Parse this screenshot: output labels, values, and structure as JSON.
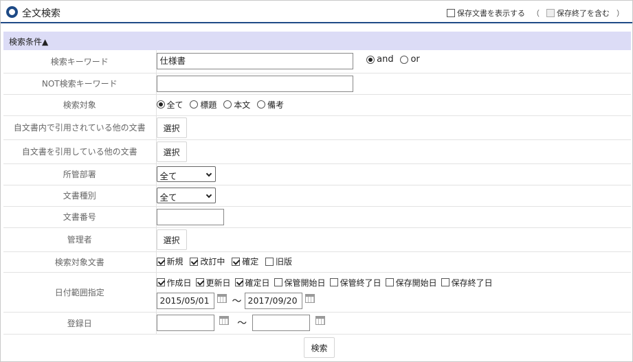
{
  "header": {
    "title": "全文検索",
    "show_saved_label": "保存文書を表示する",
    "include_ended_label": "保存終了を含む",
    "paren_open": "（",
    "paren_close": "）"
  },
  "section": {
    "title": "検索条件▲"
  },
  "fields": {
    "keyword": {
      "label": "検索キーワード",
      "value": "仕様書",
      "mode_and": "and",
      "mode_or": "or",
      "selected_mode": "and"
    },
    "not_keyword": {
      "label": "NOT検索キーワード",
      "value": ""
    },
    "target": {
      "label": "検索対象",
      "options": [
        "全て",
        "標題",
        "本文",
        "備考"
      ],
      "selected": "全て"
    },
    "cited_by_self": {
      "label": "自文書内で引用されている他の文書",
      "button": "選択"
    },
    "citing_self": {
      "label": "自文書を引用している他の文書",
      "button": "選択"
    },
    "department": {
      "label": "所管部署",
      "selected": "全て"
    },
    "doc_type": {
      "label": "文書種別",
      "selected": "全て"
    },
    "doc_number": {
      "label": "文書番号",
      "value": ""
    },
    "manager": {
      "label": "管理者",
      "button": "選択"
    },
    "target_docs": {
      "label": "検索対象文書",
      "options": [
        "新規",
        "改訂中",
        "確定",
        "旧版"
      ],
      "checked": [
        true,
        true,
        true,
        false
      ]
    },
    "date_range": {
      "label": "日付範囲指定",
      "options": [
        "作成日",
        "更新日",
        "確定日",
        "保管開始日",
        "保管終了日",
        "保存開始日",
        "保存終了日"
      ],
      "checked": [
        true,
        true,
        true,
        false,
        false,
        false,
        false
      ],
      "from": "2015/05/01",
      "to": "2017/09/20",
      "separator": "～"
    },
    "registered": {
      "label": "登録日",
      "from": "",
      "to": "",
      "separator": "～"
    }
  },
  "actions": {
    "search_button": "検索"
  },
  "icons": {
    "title": "ring-icon",
    "calendar": "calendar-icon",
    "dropdown": "chevron-down-icon"
  },
  "colors": {
    "accent": "#1e4a86",
    "section_bg": "#dcdcf6"
  }
}
